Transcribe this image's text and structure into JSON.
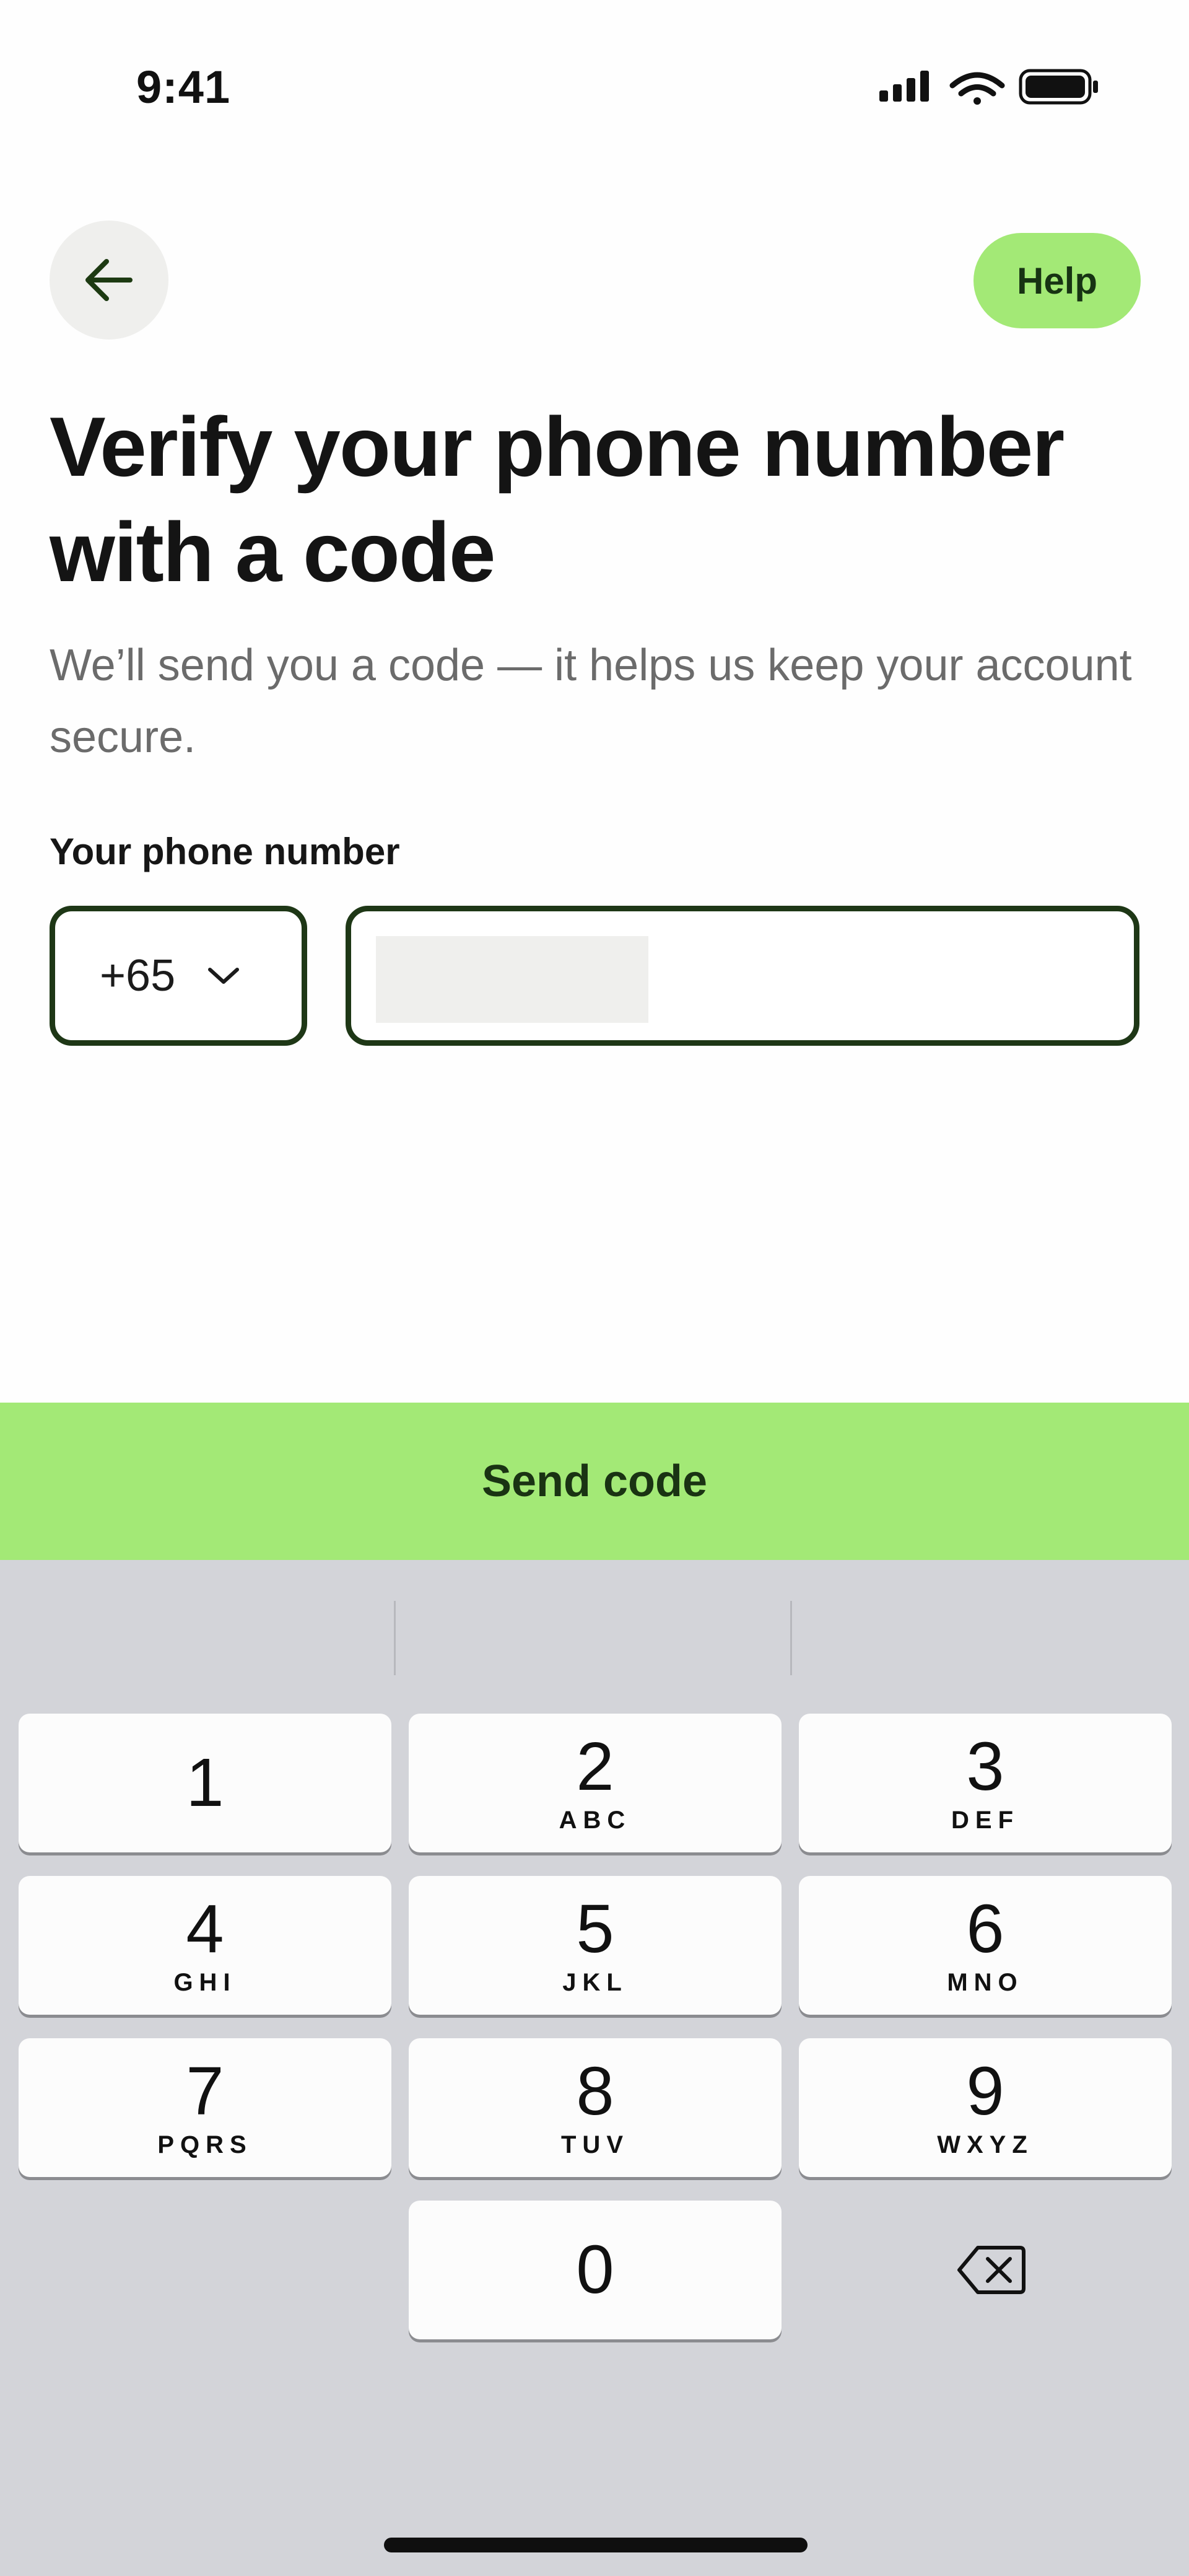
{
  "status_bar": {
    "time": "9:41"
  },
  "header": {
    "help_label": "Help"
  },
  "content": {
    "title": "Verify your phone number with a code",
    "subtitle": "We’ll send you a code — it helps us keep your account secure.",
    "phone_label": "Your phone number",
    "country_code": "+65"
  },
  "actions": {
    "send_label": "Send code"
  },
  "keypad": {
    "keys": [
      {
        "digit": "1",
        "letters": ""
      },
      {
        "digit": "2",
        "letters": "ABC"
      },
      {
        "digit": "3",
        "letters": "DEF"
      },
      {
        "digit": "4",
        "letters": "GHI"
      },
      {
        "digit": "5",
        "letters": "JKL"
      },
      {
        "digit": "6",
        "letters": "MNO"
      },
      {
        "digit": "7",
        "letters": "PQRS"
      },
      {
        "digit": "8",
        "letters": "TUV"
      },
      {
        "digit": "9",
        "letters": "WXYZ"
      },
      {
        "digit": "0",
        "letters": ""
      }
    ]
  },
  "colors": {
    "accent": "#a3e976",
    "accent_text": "#173313",
    "input_border": "#1e3716",
    "keyboard_bg": "#d3d4d9"
  }
}
